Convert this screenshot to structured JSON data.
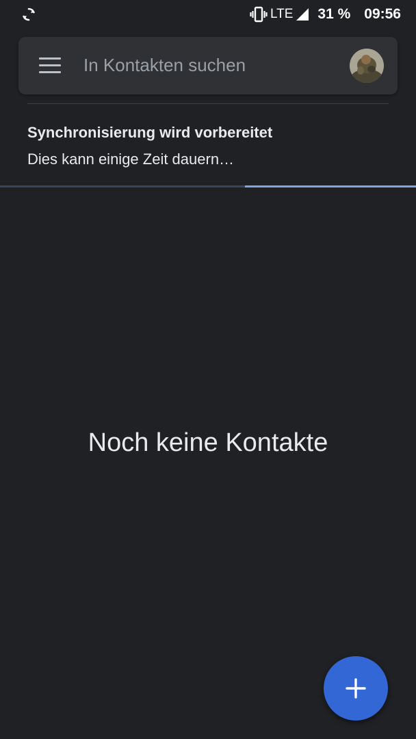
{
  "status_bar": {
    "network": "LTE",
    "battery": "31 %",
    "time": "09:56",
    "icons": [
      "sync-icon",
      "vibrate-icon",
      "signal-icon"
    ]
  },
  "search": {
    "placeholder": "In Kontakten suchen",
    "menu_icon": "menu-icon",
    "avatar": "account-avatar"
  },
  "sync": {
    "title": "Synchronisierung wird vorbereitet",
    "subtitle": "Dies kann einige Zeit dauern…",
    "progress_state": "indeterminate"
  },
  "main": {
    "empty_message": "Noch keine Kontakte"
  },
  "fab": {
    "icon": "plus-icon"
  },
  "colors": {
    "background": "#202124",
    "search_bar": "#303134",
    "accent": "#8ab4f8",
    "fab": "#3367d6"
  }
}
